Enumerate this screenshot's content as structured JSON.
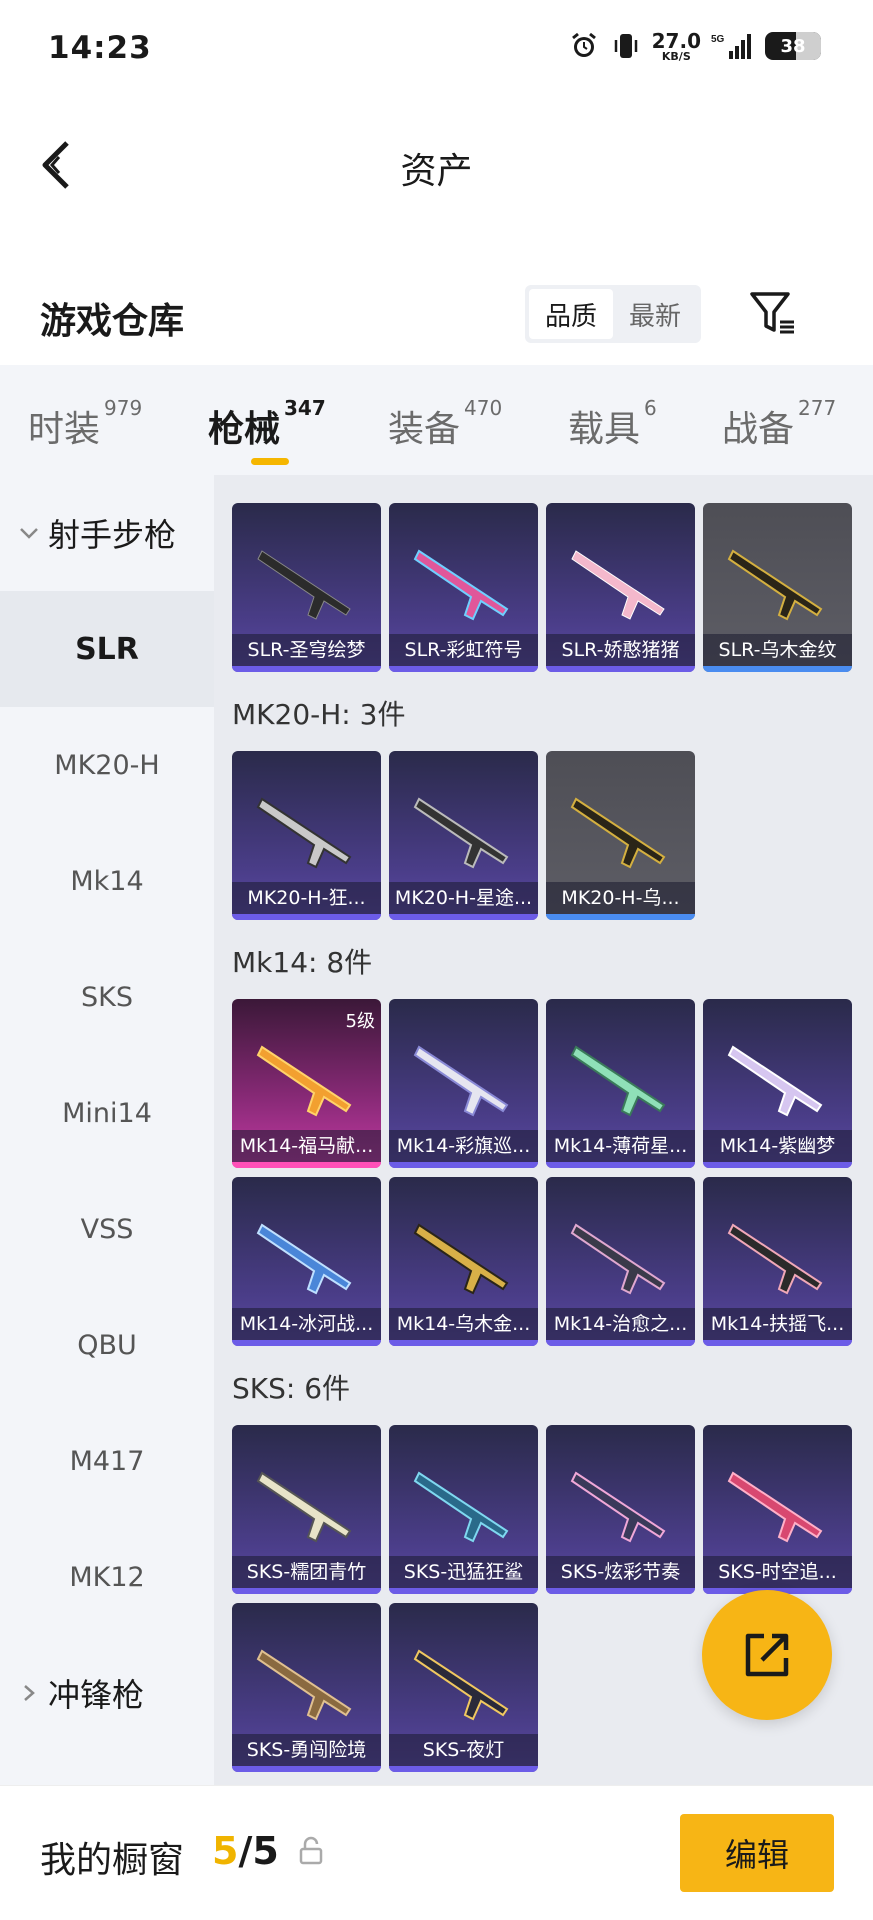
{
  "status_bar": {
    "time": "14:23",
    "net_speed": "27.0",
    "net_unit": "KB/S",
    "signal": "5G",
    "battery": "38"
  },
  "nav": {
    "title": "资产"
  },
  "warehouse": {
    "title": "游戏仓库",
    "sort_options": [
      "品质",
      "最新"
    ],
    "active_sort": "品质"
  },
  "tabs": [
    {
      "label": "时装",
      "count": "979"
    },
    {
      "label": "枪械",
      "count": "347",
      "active": true
    },
    {
      "label": "装备",
      "count": "470"
    },
    {
      "label": "载具",
      "count": "6"
    },
    {
      "label": "战备",
      "count": "277"
    }
  ],
  "sidebar": {
    "group_open": "射手步枪",
    "items": [
      "SLR",
      "MK20-H",
      "Mk14",
      "SKS",
      "Mini14",
      "VSS",
      "QBU",
      "M417",
      "MK12"
    ],
    "active_item": "SLR",
    "group_closed": "冲锋枪"
  },
  "groups": [
    {
      "title": "",
      "cards": [
        {
          "name": "SLR-圣穹绘梦",
          "tone": "purple"
        },
        {
          "name": "SLR-彩虹符号",
          "tone": "purple"
        },
        {
          "name": "SLR-娇憨猪猪",
          "tone": "purple"
        },
        {
          "name": "SLR-乌木金纹",
          "tone": "grey"
        }
      ]
    },
    {
      "title": "MK20-H: 3件",
      "cards": [
        {
          "name": "MK20-H-狂...",
          "tone": "purple"
        },
        {
          "name": "MK20-H-星途...",
          "tone": "purple"
        },
        {
          "name": "MK20-H-乌...",
          "tone": "grey"
        }
      ]
    },
    {
      "title": "Mk14: 8件",
      "cards": [
        {
          "name": "Mk14-福马献...",
          "tone": "pink",
          "level": "5级"
        },
        {
          "name": "Mk14-彩旗巡...",
          "tone": "purple"
        },
        {
          "name": "Mk14-薄荷星...",
          "tone": "purple"
        },
        {
          "name": "Mk14-紫幽梦",
          "tone": "purple"
        },
        {
          "name": "Mk14-冰河战...",
          "tone": "purple"
        },
        {
          "name": "Mk14-乌木金...",
          "tone": "purple"
        },
        {
          "name": "Mk14-治愈之...",
          "tone": "purple"
        },
        {
          "name": "Mk14-扶摇飞...",
          "tone": "purple"
        }
      ]
    },
    {
      "title": "SKS: 6件",
      "cards": [
        {
          "name": "SKS-糯团青竹",
          "tone": "purple"
        },
        {
          "name": "SKS-迅猛狂鲨",
          "tone": "purple"
        },
        {
          "name": "SKS-炫彩节奏",
          "tone": "purple"
        },
        {
          "name": "SKS-时空追...",
          "tone": "purple"
        },
        {
          "name": "SKS-勇闯险境",
          "tone": "purple"
        },
        {
          "name": "SKS-夜灯",
          "tone": "purple"
        }
      ]
    }
  ],
  "bottom": {
    "title": "我的橱窗",
    "current": "5",
    "sep": "/",
    "total": "5",
    "edit_label": "编辑"
  },
  "colors": {
    "accent": "#f7b515",
    "card_purple": "#4a3d88",
    "card_grey": "#5e5e66",
    "card_pink": "#c43aa3"
  }
}
